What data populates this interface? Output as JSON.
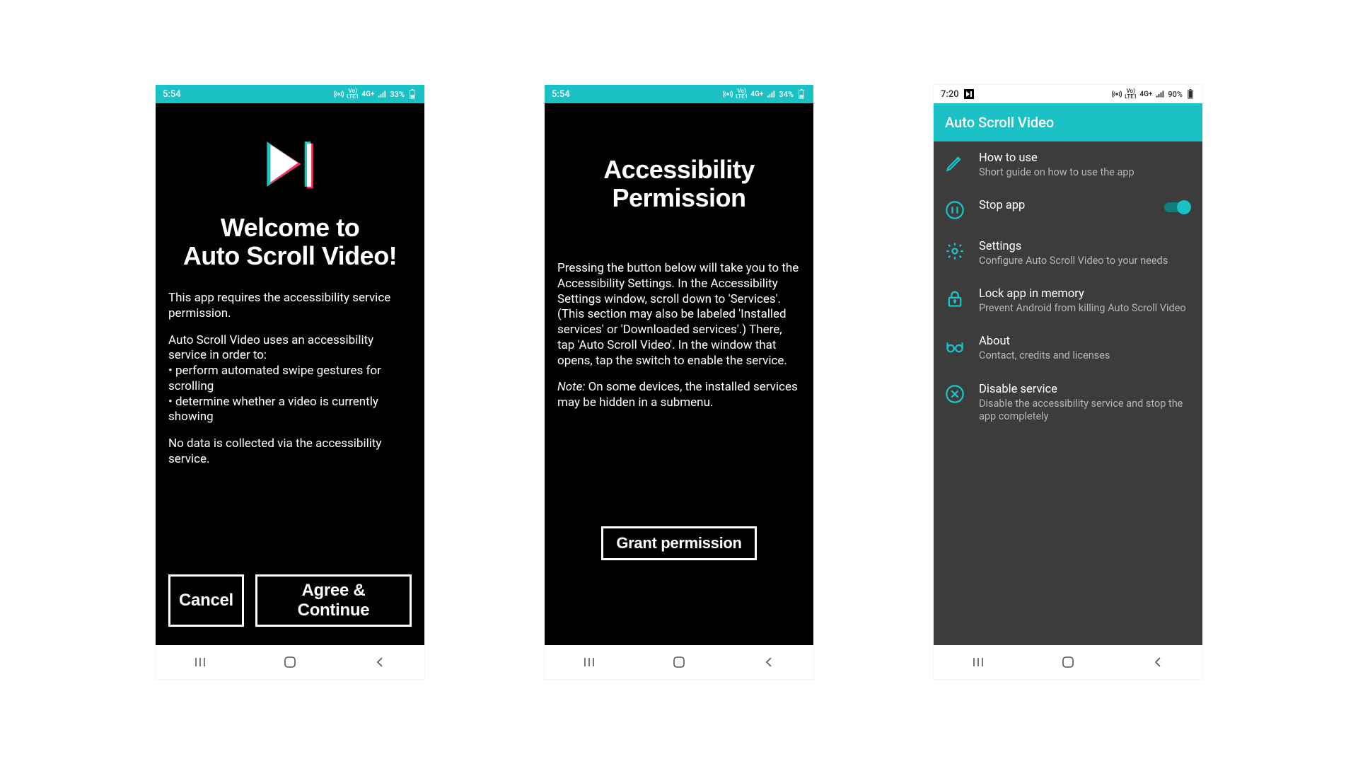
{
  "screens": [
    {
      "status": {
        "time": "5:54",
        "battery": "33%",
        "net": "Vo) 4G+ .ıl"
      },
      "title_line1": "Welcome to",
      "title_line2": "Auto Scroll Video!",
      "para1": "This app requires the accessibility service permission.",
      "para2_intro": "Auto Scroll Video uses an accessibility service in order to:",
      "bullet1": "• perform automated swipe gestures for scrolling",
      "bullet2": "• determine whether a video is currently showing",
      "para3": "No data is collected via the accessibility service.",
      "btn_cancel": "Cancel",
      "btn_agree": "Agree & Continue"
    },
    {
      "status": {
        "time": "5:54",
        "battery": "34%",
        "net": "Vo) 4G+ .ıl"
      },
      "title_line1": "Accessibility",
      "title_line2": "Permission",
      "para1": "Pressing the button below will take you to the Accessibility Settings. In the Accessibility Settings window, scroll down to 'Services'. (This section may also be labeled 'Installed services' or 'Downloaded services'.) There, tap 'Auto Scroll Video'. In the window that opens, tap the switch to enable the service.",
      "note_label": "Note:",
      "note_text": " On some devices, the installed services may be hidden in a submenu.",
      "btn_grant": "Grant permission"
    },
    {
      "status": {
        "time": "7:20",
        "battery": "90%",
        "net": "Vo) 4G+ .ıl"
      },
      "app_bar_title": "Auto Scroll Video",
      "items": [
        {
          "title": "How to use",
          "sub": "Short guide on how to use the app",
          "icon": "pencil"
        },
        {
          "title": "Stop app",
          "sub": "",
          "icon": "pause",
          "toggle": true
        },
        {
          "title": "Settings",
          "sub": "Configure Auto Scroll Video to your needs",
          "icon": "gear"
        },
        {
          "title": "Lock app in memory",
          "sub": "Prevent Android from killing Auto Scroll Video",
          "icon": "lock"
        },
        {
          "title": "About",
          "sub": "Contact, credits and licenses",
          "icon": "glasses"
        },
        {
          "title": "Disable service",
          "sub": "Disable the accessibility service and stop the app completely",
          "icon": "x-circle"
        }
      ]
    }
  ],
  "lte_label": "LTE1"
}
